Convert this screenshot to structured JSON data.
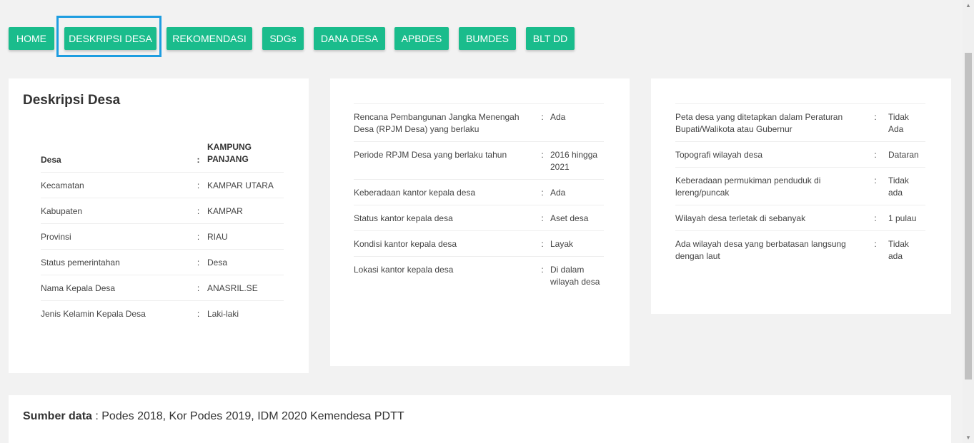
{
  "nav": {
    "items": [
      {
        "label": "HOME"
      },
      {
        "label": "DESKRIPSI DESA"
      },
      {
        "label": "REKOMENDASI"
      },
      {
        "label": "SDGs"
      },
      {
        "label": "DANA DESA"
      },
      {
        "label": "APBDES"
      },
      {
        "label": "BUMDES"
      },
      {
        "label": "BLT DD"
      }
    ]
  },
  "card1": {
    "title": "Deskripsi Desa",
    "rows": [
      {
        "label": "Desa",
        "sep": ":",
        "value": "KAMPUNG PANJANG"
      },
      {
        "label": "Kecamatan",
        "sep": ":",
        "value": "KAMPAR UTARA"
      },
      {
        "label": "Kabupaten",
        "sep": ":",
        "value": "KAMPAR"
      },
      {
        "label": "Provinsi",
        "sep": ":",
        "value": "RIAU"
      },
      {
        "label": "Status pemerintahan",
        "sep": ":",
        "value": "Desa"
      },
      {
        "label": "Nama Kepala Desa",
        "sep": ":",
        "value": "ANASRIL.SE"
      },
      {
        "label": "Jenis Kelamin Kepala Desa",
        "sep": ":",
        "value": "Laki-laki"
      }
    ]
  },
  "card2": {
    "rows": [
      {
        "label": "Rencana Pembangunan Jangka Menengah Desa (RPJM Desa) yang berlaku",
        "sep": ":",
        "value": "Ada"
      },
      {
        "label": "Periode RPJM Desa yang berlaku tahun",
        "sep": ":",
        "value": "2016 hingga 2021"
      },
      {
        "label": "Keberadaan kantor kepala desa",
        "sep": ":",
        "value": "Ada"
      },
      {
        "label": "Status kantor kepala desa",
        "sep": ":",
        "value": "Aset desa"
      },
      {
        "label": "Kondisi kantor kepala desa",
        "sep": ":",
        "value": "Layak"
      },
      {
        "label": "Lokasi kantor kepala desa",
        "sep": ":",
        "value": "Di dalam wilayah desa"
      }
    ]
  },
  "card3": {
    "rows": [
      {
        "label": "Peta desa yang ditetapkan dalam Peraturan Bupati/Walikota atau Gubernur",
        "sep": ":",
        "value": "Tidak Ada"
      },
      {
        "label": "Topografi wilayah desa",
        "sep": ":",
        "value": "Dataran"
      },
      {
        "label": "Keberadaan permukiman penduduk di lereng/puncak",
        "sep": ":",
        "value": "Tidak ada"
      },
      {
        "label": "Wilayah desa terletak di sebanyak",
        "sep": ":",
        "value": "1 pulau"
      },
      {
        "label": "Ada wilayah desa yang berbatasan langsung dengan laut",
        "sep": ":",
        "value": "Tidak ada"
      }
    ]
  },
  "footer": {
    "label": "Sumber data",
    "text": " : Podes 2018, Kor Podes 2019, IDM 2020 Kemendesa PDTT"
  },
  "colors": {
    "accent": "#1abc8c",
    "highlight": "#1e9de0"
  }
}
